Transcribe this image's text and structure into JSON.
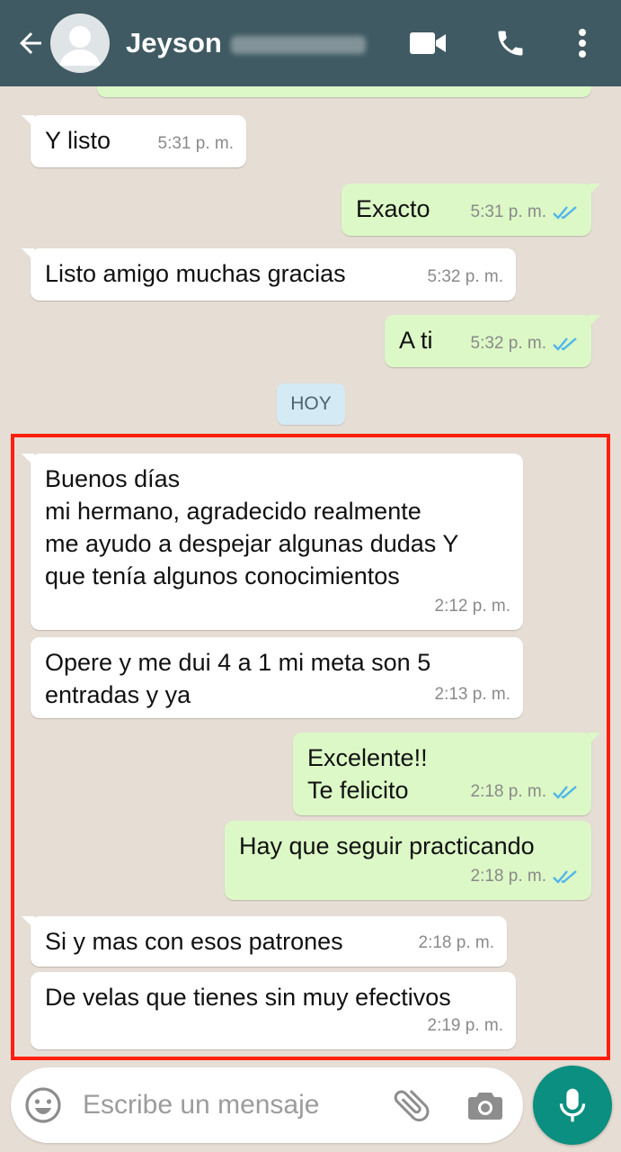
{
  "header": {
    "contact_name": "Jeyson",
    "back_icon": "arrow-left-icon",
    "avatar_icon": "default-avatar-icon",
    "video_icon": "video-camera-icon",
    "call_icon": "phone-icon",
    "menu_icon": "more-vertical-icon",
    "background_color": "#3f5a63"
  },
  "messages_before": [
    {
      "direction": "in",
      "text": "Y listo",
      "time": "5:31 p. m."
    },
    {
      "direction": "out",
      "text": "Exacto",
      "time": "5:31 p. m.",
      "status": "read"
    },
    {
      "direction": "in",
      "text": "Listo amigo muchas gracias",
      "time": "5:32 p. m."
    },
    {
      "direction": "out",
      "text": "A ti",
      "time": "5:32 p. m.",
      "status": "read"
    }
  ],
  "day_separator": "HOY",
  "messages_today": [
    {
      "direction": "in",
      "lines": [
        "Buenos días",
        "mi hermano, agradecido realmente",
        "me ayudo a despejar algunas dudas Y",
        "que tenía algunos conocimientos"
      ],
      "time": "2:12 p. m."
    },
    {
      "direction": "in",
      "lines": [
        "Opere y me dui 4 a 1 mi meta son 5",
        "entradas y ya"
      ],
      "time": "2:13 p. m."
    },
    {
      "direction": "out",
      "lines": [
        "Excelente!!",
        "Te felicito"
      ],
      "time": "2:18 p. m.",
      "status": "read"
    },
    {
      "direction": "out",
      "lines": [
        "Hay que seguir practicando"
      ],
      "time": "2:18 p. m.",
      "status": "read"
    },
    {
      "direction": "in",
      "lines": [
        "Si y mas con esos patrones"
      ],
      "time": "2:18 p. m."
    },
    {
      "direction": "in",
      "lines": [
        "De velas que tienes sin muy efectivos"
      ],
      "time": "2:19 p. m."
    }
  ],
  "composer": {
    "placeholder": "Escribe un mensaje",
    "emoji_icon": "emoji-icon",
    "attach_icon": "paperclip-icon",
    "camera_icon": "camera-icon",
    "mic_icon": "microphone-icon"
  },
  "colors": {
    "incoming_bubble": "#ffffff",
    "outgoing_bubble": "#dcf8c6",
    "read_ticks": "#4fb6ec",
    "highlight_border": "#ff1f0f",
    "mic_button": "#0a8f80"
  }
}
